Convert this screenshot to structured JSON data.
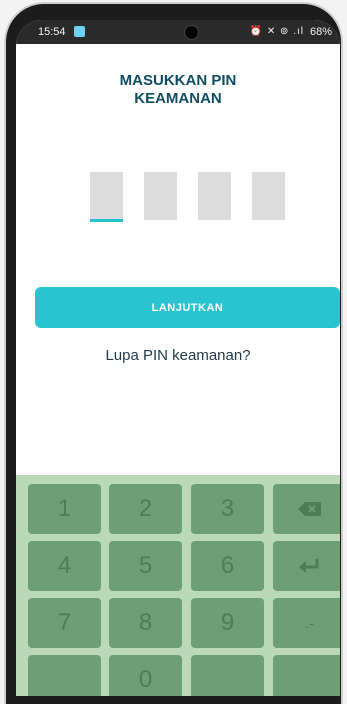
{
  "status_bar": {
    "time": "15:54",
    "icons": "⏰ ✕ ⊚ .ıl",
    "battery": "68%"
  },
  "pin_screen": {
    "title_line1": "MASUKKAN PIN",
    "title_line2": "KEAMANAN",
    "digits_total": 4,
    "digits_entered": 0,
    "continue_label": "LANJUTKAN",
    "forgot_label": "Lupa PIN keamanan?"
  },
  "keypad": {
    "keys": [
      "1",
      "2",
      "3",
      "4",
      "5",
      "6",
      "7",
      "8",
      "9",
      "0"
    ],
    "dash_label": ".-",
    "backspace_icon": "backspace-icon",
    "enter_icon": "enter-icon"
  },
  "colors": {
    "accent": "#2ac4d0",
    "title": "#0e4d63",
    "keypad_bg": "#b9d9b7",
    "key_bg": "#6e9f72"
  }
}
